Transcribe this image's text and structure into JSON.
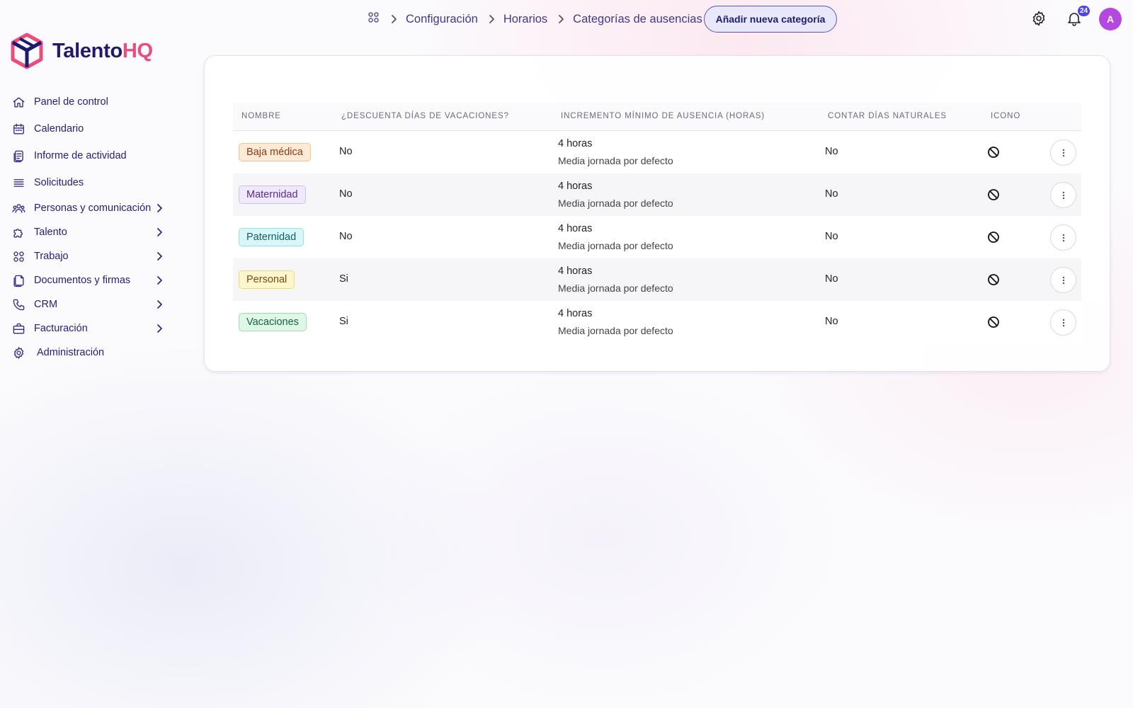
{
  "brand": {
    "name_part1": "Talento",
    "name_part2": "HQ",
    "colors": {
      "primary": "#1e1b6e",
      "accent": "#ea4d7c"
    }
  },
  "breadcrumb": {
    "home_icon": "apps-grid-icon",
    "items": [
      "Configuración",
      "Horarios",
      "Categorías de ausencias"
    ]
  },
  "header": {
    "add_button_label": "Añadir nueva categoría",
    "notification_count": "24",
    "avatar_initial": "A"
  },
  "sidebar": {
    "items": [
      {
        "label": "Panel de control",
        "icon": "home-icon",
        "has_submenu": false
      },
      {
        "label": "Calendario",
        "icon": "calendar-icon",
        "has_submenu": false
      },
      {
        "label": "Informe de actividad",
        "icon": "activity-report-icon",
        "has_submenu": false
      },
      {
        "label": "Solicitudes",
        "icon": "list-icon",
        "has_submenu": false
      },
      {
        "label": "Personas y comunicación",
        "icon": "people-icon",
        "has_submenu": true
      },
      {
        "label": "Talento",
        "icon": "puzzle-icon",
        "has_submenu": true
      },
      {
        "label": "Trabajo",
        "icon": "grid-icon",
        "has_submenu": true
      },
      {
        "label": "Documentos y firmas",
        "icon": "documents-icon",
        "has_submenu": true
      },
      {
        "label": "CRM",
        "icon": "phone-icon",
        "has_submenu": true
      },
      {
        "label": "Facturación",
        "icon": "briefcase-icon",
        "has_submenu": true
      },
      {
        "label": "Administración",
        "icon": "gear-icon",
        "has_submenu": false
      }
    ]
  },
  "table": {
    "headers": [
      "NOMBRE",
      "¿DESCUENTA DÍAS DE VACACIONES?",
      "INCREMENTO MÍNIMO DE AUSENCIA (HORAS)",
      "CONTAR DÍAS NATURALES",
      "ICONO"
    ],
    "rows": [
      {
        "name": "Baja médica",
        "discounts": "No",
        "increment": "4 horas",
        "increment_note": "Media jornada por defecto",
        "natural_days": "No",
        "icon": "ban-icon",
        "badge": {
          "bg": "#fdebd8",
          "border": "#f3c38f",
          "text": "#8a3b12"
        }
      },
      {
        "name": "Maternidad",
        "discounts": "No",
        "increment": "4 horas",
        "increment_note": "Media jornada por defecto",
        "natural_days": "No",
        "icon": "ban-icon",
        "badge": {
          "bg": "#efe9fb",
          "border": "#cfc0f0",
          "text": "#5b2a9e"
        }
      },
      {
        "name": "Paternidad",
        "discounts": "No",
        "increment": "4 horas",
        "increment_note": "Media jornada por defecto",
        "natural_days": "No",
        "icon": "ban-icon",
        "badge": {
          "bg": "#d9f7f8",
          "border": "#8fe2e7",
          "text": "#125e66"
        }
      },
      {
        "name": "Personal",
        "discounts": "Si",
        "increment": "4 horas",
        "increment_note": "Media jornada por defecto",
        "natural_days": "No",
        "icon": "ban-icon",
        "badge": {
          "bg": "#fdf6cf",
          "border": "#f0d77a",
          "text": "#7a4b0c"
        }
      },
      {
        "name": "Vacaciones",
        "discounts": "Si",
        "increment": "4 horas",
        "increment_note": "Media jornada por defecto",
        "natural_days": "No",
        "icon": "ban-icon",
        "badge": {
          "bg": "#dff7e6",
          "border": "#9fe0b3",
          "text": "#17623a"
        }
      }
    ]
  }
}
